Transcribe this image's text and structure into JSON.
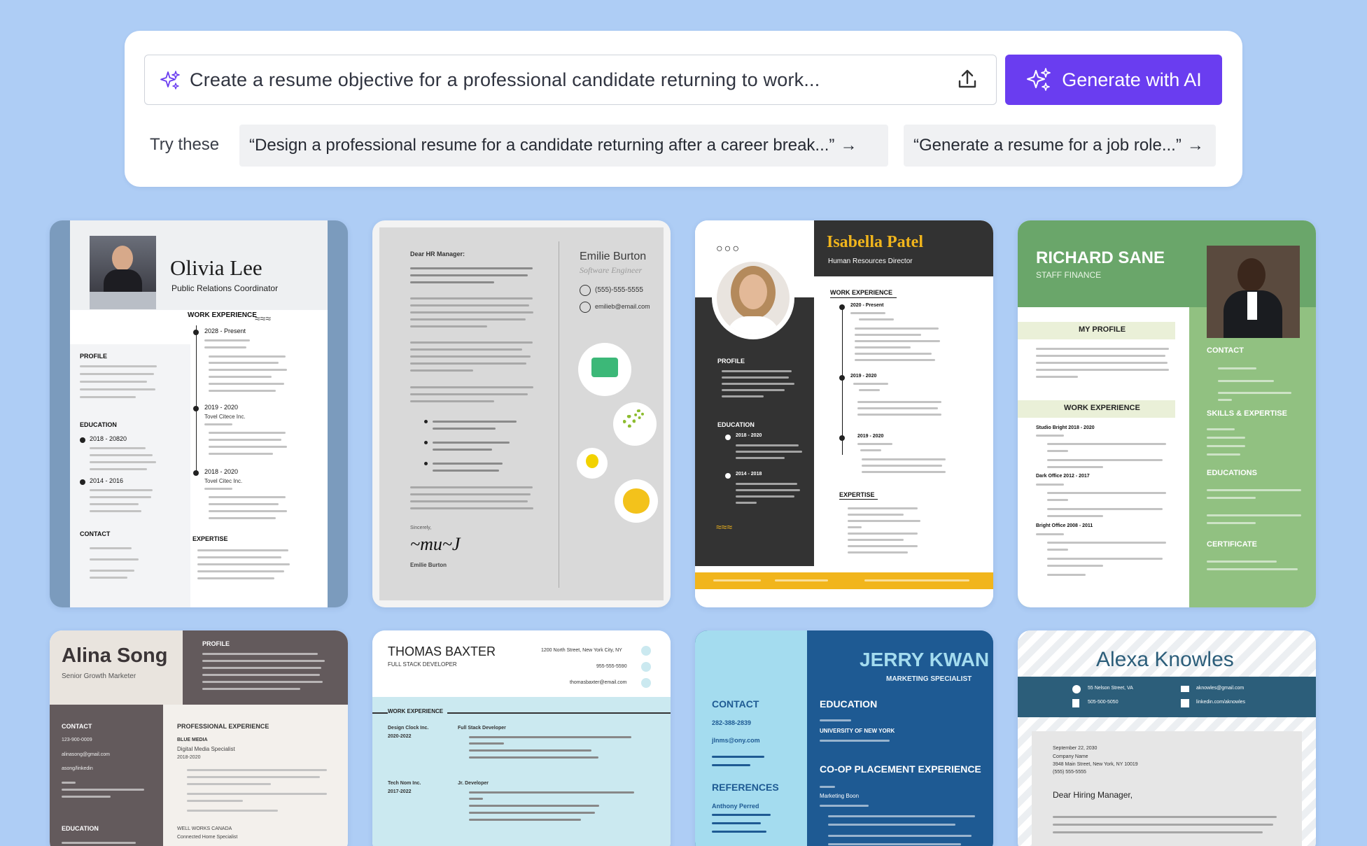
{
  "prompt": {
    "value": "Create a resume objective for a professional candidate returning to work...",
    "generate_label": "Generate with AI",
    "try_label": "Try these",
    "suggestions": [
      "“Design a professional resume for a candidate returning after a career break...”",
      "“Generate a resume for a job role...”"
    ]
  },
  "colors": {
    "accent": "#6a3df0",
    "background": "#aecdf5"
  },
  "templates": {
    "olivia": {
      "name": "Olivia Lee",
      "title": "Public Relations Coordinator",
      "work": "WORK EXPERIENCE",
      "profile": "PROFILE",
      "education": "EDUCATION",
      "contact": "CONTACT",
      "expertise": "EXPERTISE",
      "d1": "2028 - Present",
      "d2": "2019 - 2020",
      "d3": "2018 - 2020",
      "e1": "2018 - 20820",
      "e2": "2014 - 2016",
      "co1": "Tovel Citece Inc.",
      "co2": "Tovel Citec Inc."
    },
    "emilie": {
      "name": "Emilie Burton",
      "title": "Software Engineer",
      "phone": "(555)-555-5555",
      "email": "emilieb@email.com",
      "greeting": "Dear HR Manager:",
      "sincerely": "Sincerely,",
      "signature": "Emilie Burton"
    },
    "isabella": {
      "name": "Isabella Patel",
      "title": "Human Resources Director",
      "work": "WORK EXPERIENCE",
      "profile": "PROFILE",
      "education": "EDUCATION",
      "expertise": "EXPERTISE",
      "d1": "2020 - Present",
      "d2": "2019 - 2020",
      "d3": "2019 - 2020",
      "e1": "2018 - 2020",
      "e2": "2014 - 2018"
    },
    "richard": {
      "name": "RICHARD SANE",
      "title": "STAFF FINANCE",
      "profile": "MY PROFILE",
      "work": "WORK EXPERIENCE",
      "contact": "CONTACT",
      "skills": "SKILLS & EXPERTISE",
      "education": "EDUCATIONS",
      "certificate": "CERTIFICATE",
      "j1": "Studio Bright 2018 - 2020",
      "j2": "Dark Office 2012 - 2017",
      "j3": "Bright Office 2008 - 2011"
    },
    "alina": {
      "name": "Alina Song",
      "title": "Senior Growth Marketer",
      "profile": "PROFILE",
      "contact": "CONTACT",
      "experience": "PROFESSIONAL EXPERIENCE",
      "education": "EDUCATION",
      "phone": "123-900-0009",
      "email": "alinasong@gmail.com",
      "linkedin": "asong/linkedin",
      "company": "BLUE MEDIA",
      "role": "Digital Media Specialist",
      "dates": "2018-2020",
      "company2": "WELL WORKS CANADA",
      "role2": "Connected Home Specialist"
    },
    "thomas": {
      "name": "THOMAS BAXTER",
      "title": "FULL STACK DEVELOPER",
      "address": "1200 North Street, New York City, NY",
      "phone": "955-555-5590",
      "email": "thomasbaxter@email.com",
      "work": "WORK EXPERIENCE",
      "c1": "Design Clock Inc.",
      "d1": "2020-2022",
      "r1": "Full Stack Developer",
      "c2": "Tech Nom Inc.",
      "d2": "2017-2022",
      "r2": "Jr. Developer"
    },
    "jerry": {
      "name": "JERRY KWAN",
      "title": "MARKETING SPECIALIST",
      "contact": "CONTACT",
      "education": "EDUCATION",
      "references": "REFERENCES",
      "coop": "CO-OP PLACEMENT EXPERIENCE",
      "phone": "282-388-2839",
      "email": "jlnms@ony.com",
      "ref": "Anthony Perred",
      "school": "UNIVERSITY OF NEW YORK",
      "job": "Marketing Boon"
    },
    "alexa": {
      "name": "Alexa Knowles",
      "address": "55 Nelson Street, VA",
      "email": "aknowles@gmail.com",
      "phone": "505-500-5050",
      "linkedin": "linkedin.com/aknowles",
      "date": "September 22, 2030",
      "company": "Company Name",
      "street": "3948 Main Street, New York, NY 10019",
      "tel": "(555) 555-5555",
      "greeting": "Dear Hiring Manager,"
    }
  }
}
